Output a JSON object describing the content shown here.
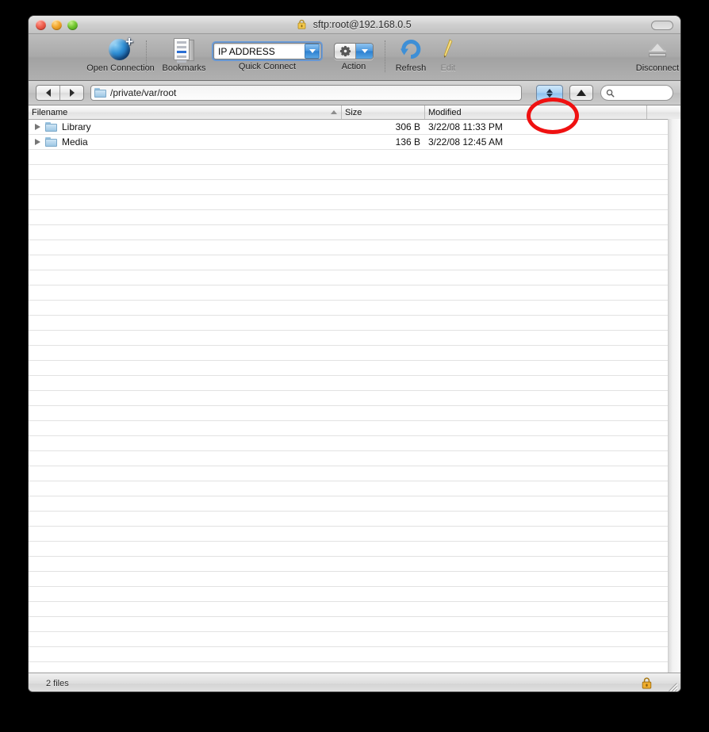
{
  "window": {
    "title": "sftp:root@192.168.0.5",
    "title_icon": "lock-icon",
    "controls": {
      "close": "close-button",
      "minimize": "minimize-button",
      "zoom": "zoom-button"
    }
  },
  "toolbar": {
    "items": [
      {
        "id": "open-connection",
        "label": "Open Connection",
        "icon": "globe-plus-icon",
        "enabled": true
      },
      {
        "id": "bookmarks",
        "label": "Bookmarks",
        "icon": "bookmarks-icon",
        "enabled": true
      },
      {
        "id": "quick-connect",
        "label": "Quick Connect",
        "icon": "combo-box",
        "enabled": true
      },
      {
        "id": "action",
        "label": "Action",
        "icon": "gear-icon",
        "enabled": true
      },
      {
        "id": "refresh",
        "label": "Refresh",
        "icon": "refresh-icon",
        "enabled": true
      },
      {
        "id": "edit",
        "label": "Edit",
        "icon": "pencil-icon",
        "enabled": false
      },
      {
        "id": "disconnect",
        "label": "Disconnect",
        "icon": "eject-icon",
        "enabled": true
      }
    ],
    "quick_connect": {
      "value": "IP ADDRESS",
      "placeholder": "IP ADDRESS",
      "dropdown_icon": "chevron-down-icon"
    }
  },
  "navbar": {
    "back_icon": "chevron-left-icon",
    "forward_icon": "chevron-right-icon",
    "path": "/private/var/root",
    "path_icon": "folder-icon",
    "history_stepper_icon": "up-down-stepper-icon",
    "parent_icon": "triangle-up-icon",
    "search": {
      "placeholder": "",
      "value": "",
      "icon": "search-icon"
    }
  },
  "annotation": {
    "shape": "ellipse",
    "color": "#ef1111",
    "target": "history-stepper"
  },
  "file_list": {
    "columns": [
      {
        "id": "filename",
        "label": "Filename",
        "sorted": true,
        "sort_icon": "triangle-up-icon"
      },
      {
        "id": "size",
        "label": "Size",
        "sorted": false
      },
      {
        "id": "modified",
        "label": "Modified",
        "sorted": false
      }
    ],
    "rows": [
      {
        "name": "Library",
        "size": "306 B",
        "modified": "3/22/08 11:33 PM",
        "icon": "folder-icon",
        "expandable": true
      },
      {
        "name": "Media",
        "size": "136 B",
        "modified": "3/22/08 12:45 AM",
        "icon": "folder-icon",
        "expandable": true
      }
    ],
    "empty_row_count": 36
  },
  "statusbar": {
    "text": "2 files",
    "lock_icon": "lock-icon",
    "grip_icon": "resize-grip-icon"
  },
  "colors": {
    "accent_blue": "#4a96dd",
    "annotation_red": "#ef1111",
    "folder_blue": "#9ec7e4"
  }
}
